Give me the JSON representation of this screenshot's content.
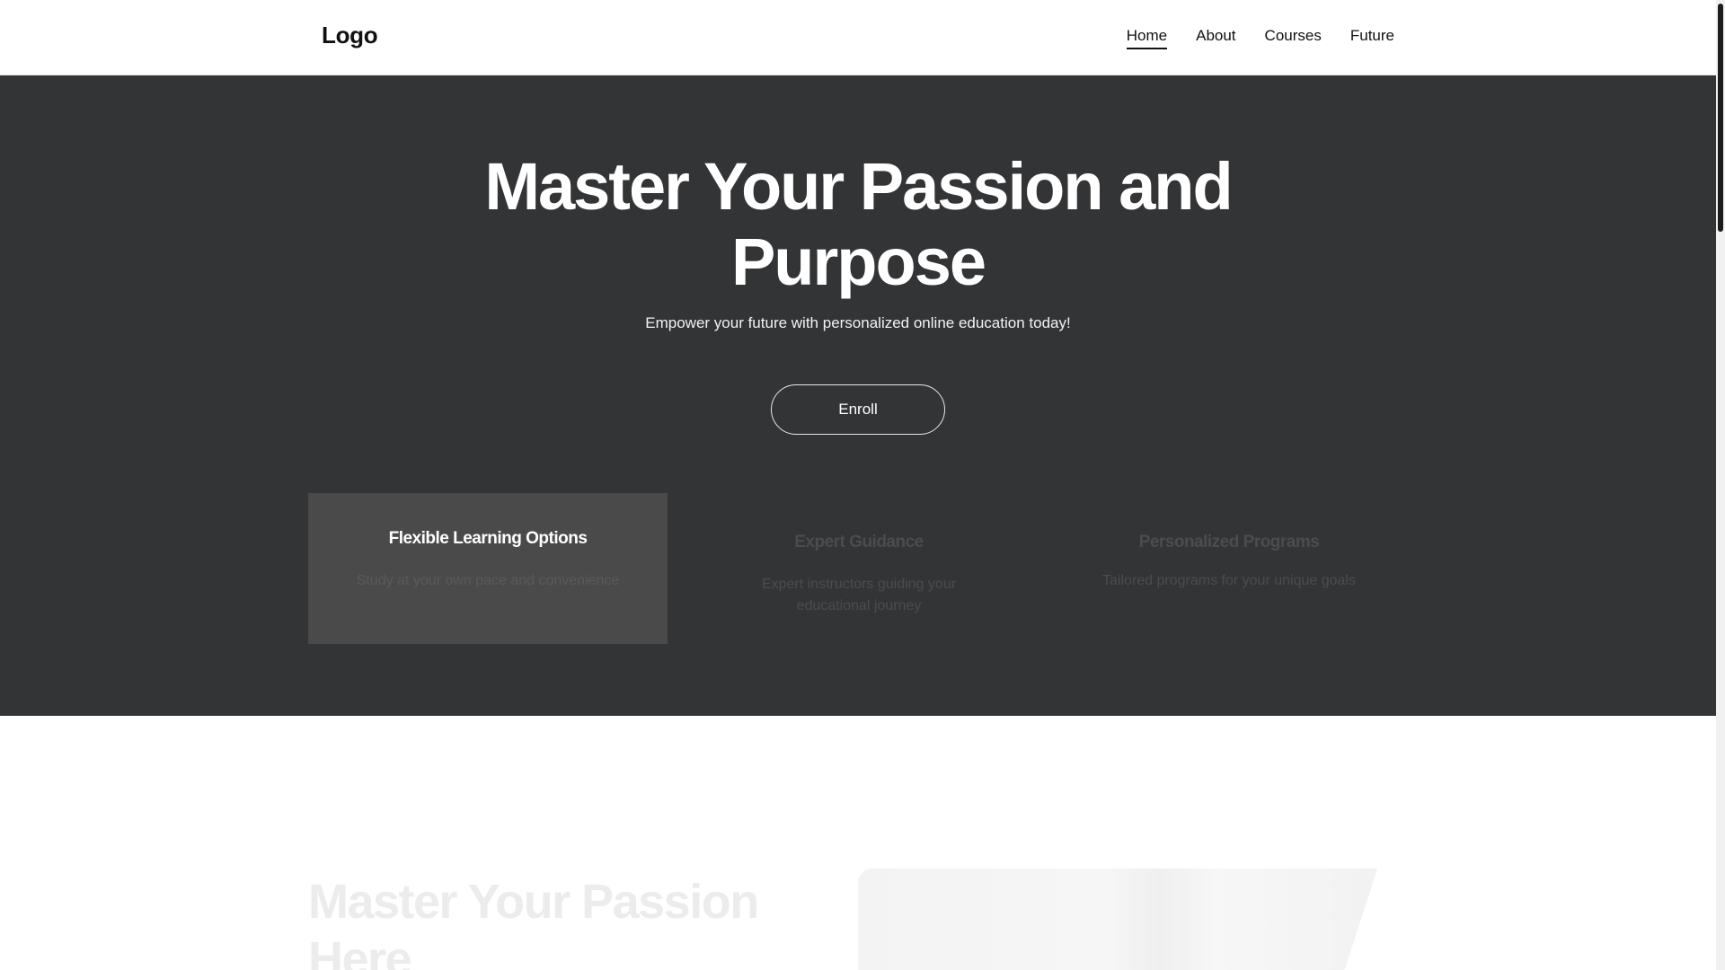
{
  "header": {
    "logo": "Logo",
    "nav": [
      {
        "label": "Home",
        "active": true
      },
      {
        "label": "About",
        "active": false
      },
      {
        "label": "Courses",
        "active": false
      },
      {
        "label": "Future",
        "active": false
      }
    ]
  },
  "hero": {
    "title_line1": "Master Your Passion and",
    "title_line2": "Purpose",
    "subtitle": "Empower your future with personalized online education today!",
    "enroll_label": "Enroll"
  },
  "features": [
    {
      "title": "Flexible Learning Options",
      "text": "Study at your own pace and convenience"
    },
    {
      "title": "Expert Guidance",
      "text": "Expert instructors guiding your educational journey"
    },
    {
      "title": "Personalized Programs",
      "text": "Tailored programs for your unique goals"
    }
  ],
  "section2": {
    "title_line1": "Master Your Passion",
    "title_line2": "Here"
  },
  "colors": {
    "hero_bg": "#333436",
    "active_feature_bg": "#4a4a4b",
    "accent_text": "#ffffff"
  }
}
